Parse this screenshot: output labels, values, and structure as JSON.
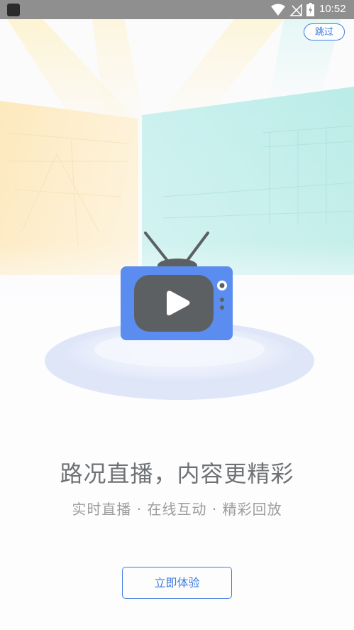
{
  "status_bar": {
    "time": "10:52",
    "icons": [
      "app-icon",
      "wifi-icon",
      "no-signal-icon",
      "battery-charging-icon"
    ]
  },
  "skip_button": {
    "label": "跳过"
  },
  "illustration": {
    "icon": "tv-play-icon",
    "colors": {
      "tv_body": "#5b8df0",
      "screen": "#5d6062",
      "play": "#ffffff",
      "stage": "#dfe6f8"
    }
  },
  "headline": "路况直播，内容更精彩",
  "subline": "实时直播 · 在线互动 · 精彩回放",
  "cta": {
    "label": "立即体验"
  },
  "colors": {
    "accent": "#3f7ce0",
    "headline": "#6f7275",
    "subline": "#9a9c9e"
  }
}
